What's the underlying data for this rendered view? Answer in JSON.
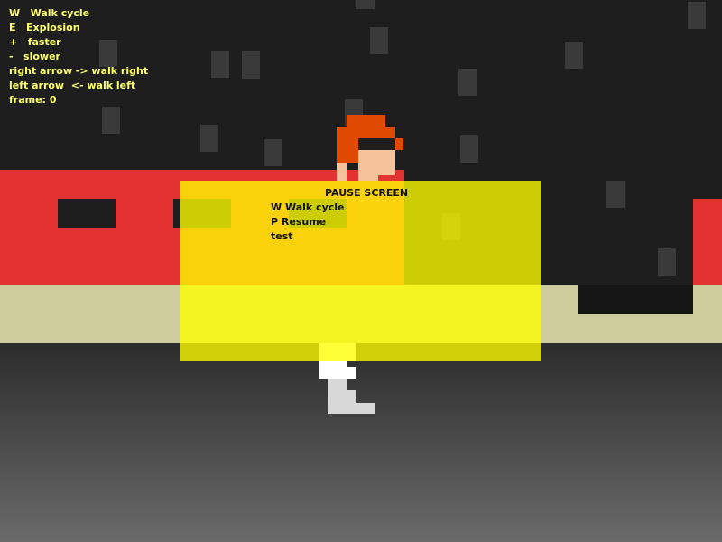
{
  "hud": {
    "lines": [
      "W   Walk cycle",
      "E   Explosion",
      "+   faster",
      "-   slower",
      "right arrow -> walk right",
      "left arrow  <- walk left"
    ],
    "frame_label": "frame:",
    "frame_value": "0"
  },
  "pause_menu": {
    "title": "PAUSE SCREEN",
    "items": [
      "W Walk cycle",
      "P Resume",
      "test"
    ]
  },
  "colors": {
    "sky": "#1e1e1e",
    "red_building": "#e23232",
    "sidewalk": "#cccc9c",
    "hud_text": "#ffff6e",
    "overlay": "#ffff00",
    "hair": "#e04a00",
    "skin": "#f5c39a"
  }
}
